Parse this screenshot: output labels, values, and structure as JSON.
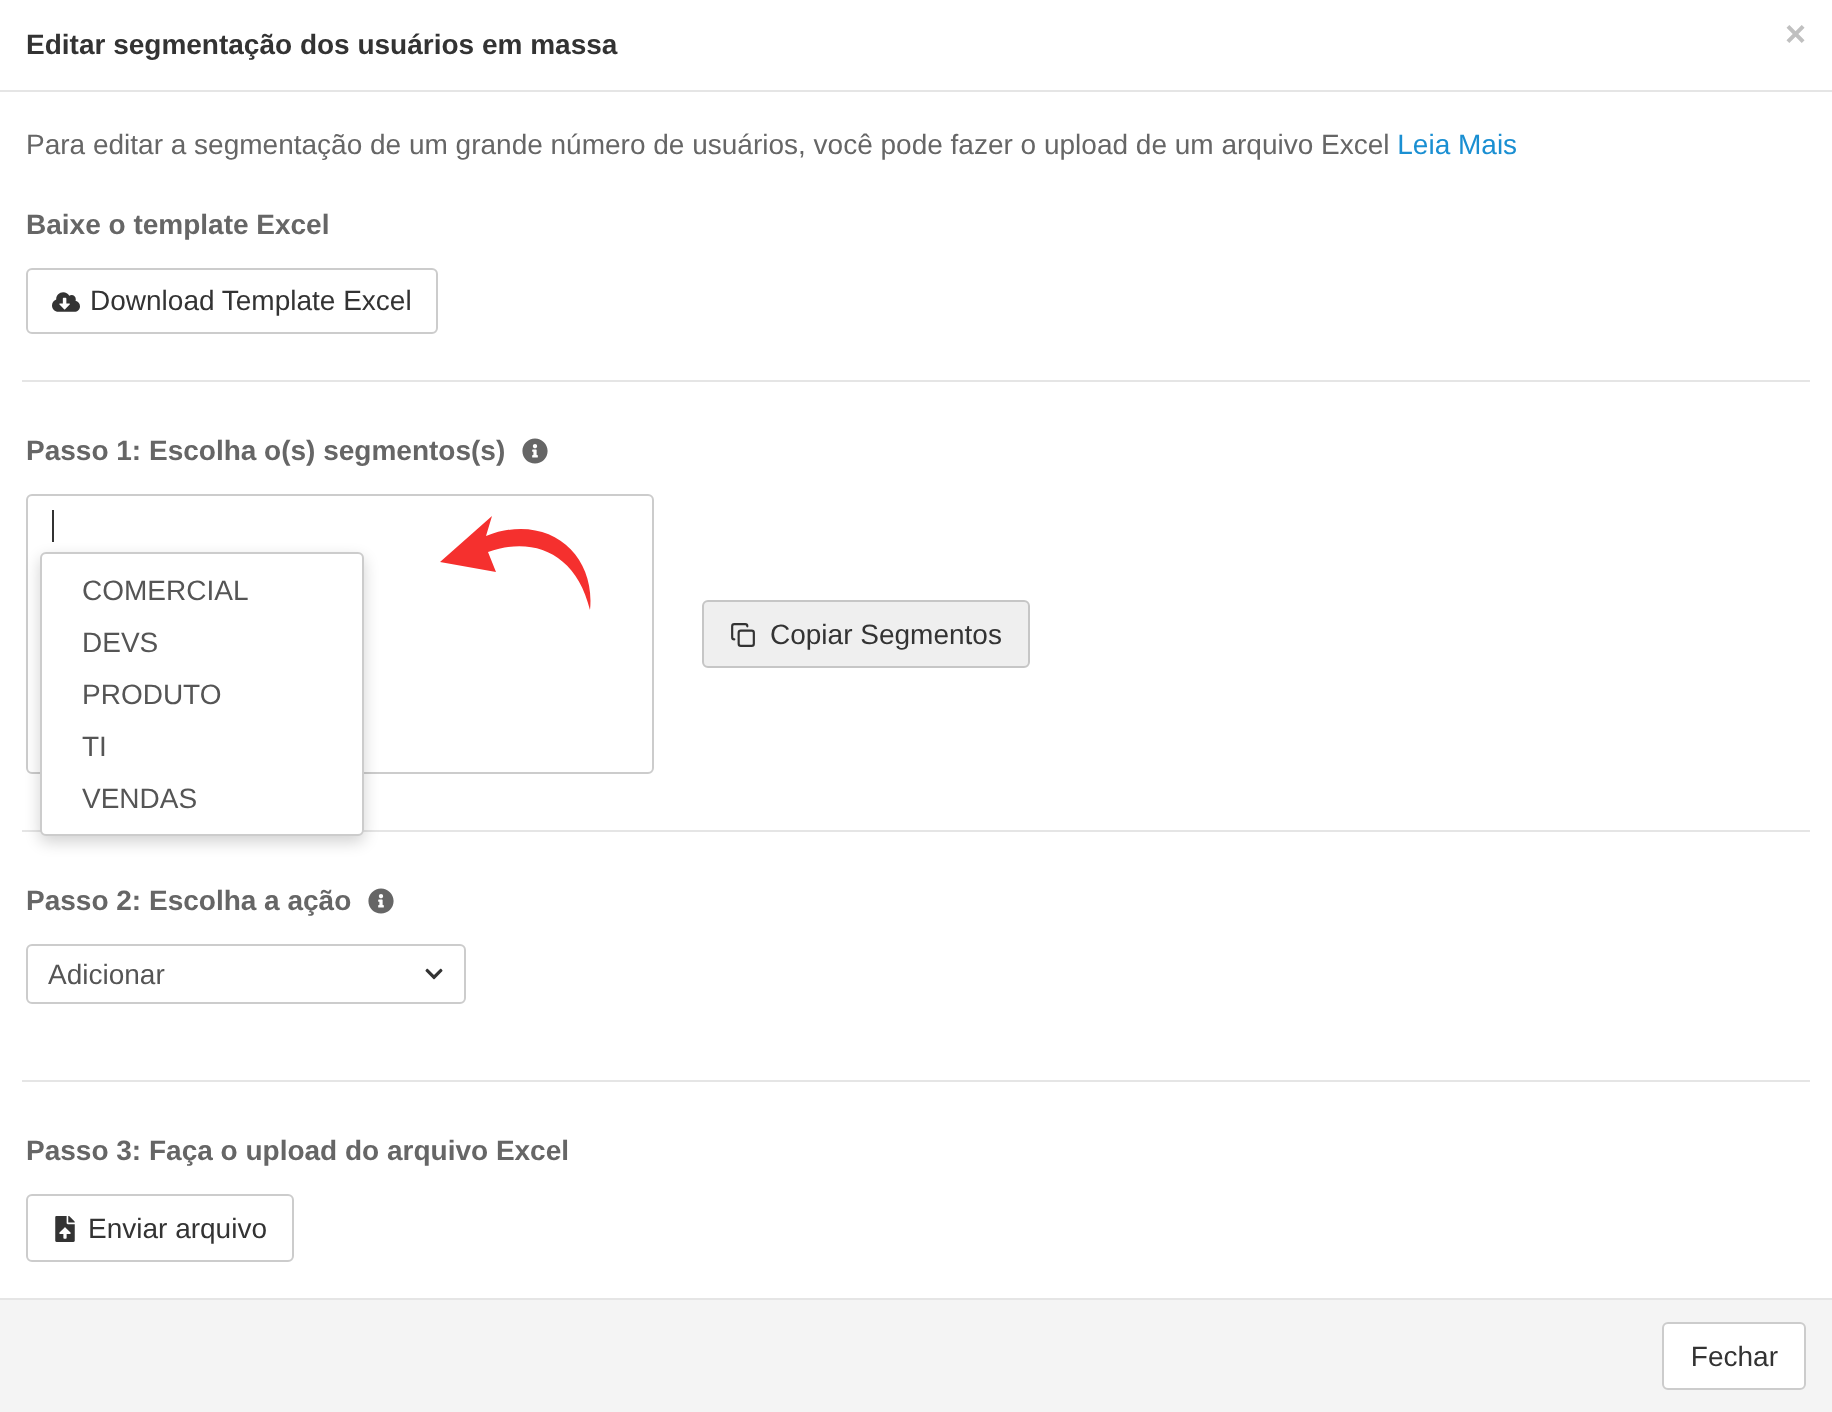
{
  "dialog": {
    "title": "Editar segmentação dos usuários em massa",
    "close": "×"
  },
  "intro": {
    "text": "Para editar a segmentação de um grande número de usuários, você pode fazer o upload de um arquivo Excel",
    "link": "Leia Mais"
  },
  "template": {
    "heading": "Baixe o template Excel",
    "button": "Download Template Excel"
  },
  "step1": {
    "heading": "Passo 1: Escolha o(s) segmentos(s)",
    "copy_button": "Copiar Segmentos",
    "options": [
      {
        "label": "COMERCIAL"
      },
      {
        "label": "DEVS"
      },
      {
        "label": "PRODUTO"
      },
      {
        "label": "TI"
      },
      {
        "label": "VENDAS"
      }
    ]
  },
  "step2": {
    "heading": "Passo 2: Escolha a ação",
    "select_value": "Adicionar"
  },
  "step3": {
    "heading": "Passo 3: Faça o upload do arquivo Excel",
    "button": "Enviar arquivo"
  },
  "footer": {
    "button": "Fechar"
  }
}
